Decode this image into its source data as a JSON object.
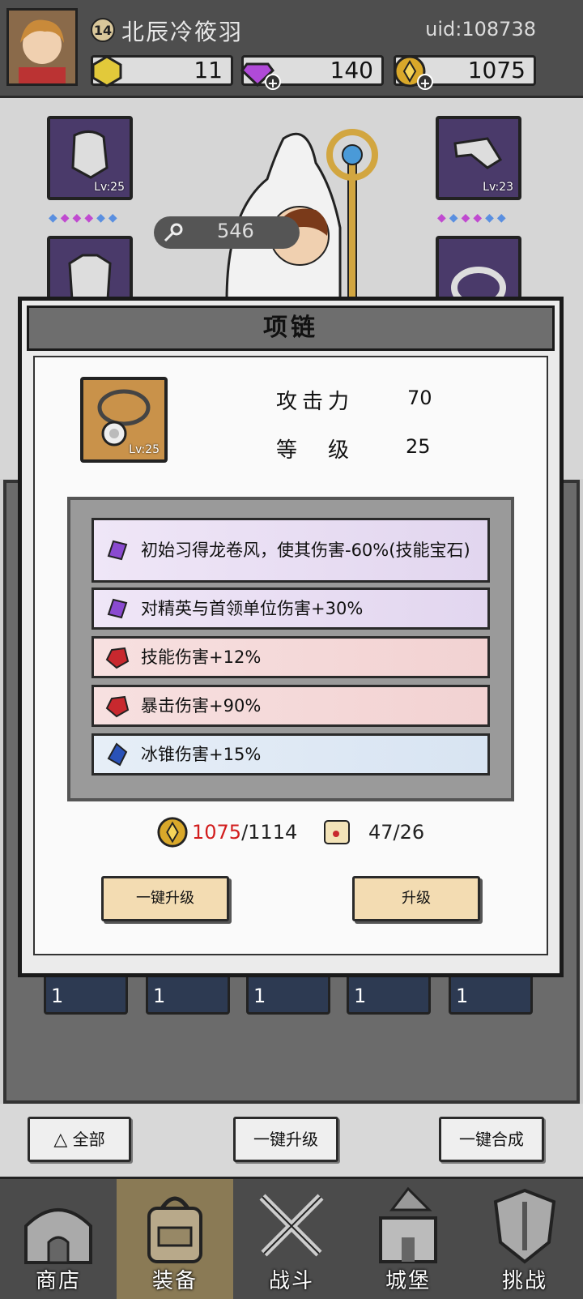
{
  "header": {
    "level": "14",
    "player_name": "北辰冷筱羽",
    "uid": "uid:108738",
    "resources": [
      {
        "icon": "yellow-gem-icon",
        "value": "11"
      },
      {
        "icon": "purple-diamond-icon",
        "value": "140"
      },
      {
        "icon": "gold-coin-icon",
        "value": "1075"
      }
    ]
  },
  "background": {
    "key_count": "546",
    "slots": {
      "helmet_lv": "Lv:25",
      "gloves_lv": "Lv:23"
    }
  },
  "modal": {
    "title": "项链",
    "item_level": "Lv:25",
    "stats": [
      {
        "label": "攻击力",
        "value": "70"
      },
      {
        "label": "等　级",
        "value": "25"
      }
    ],
    "affixes": [
      {
        "color": "purple",
        "text": "初始习得龙卷风，使其伤害-60%(技能宝石)"
      },
      {
        "color": "purple",
        "text": "对精英与首领单位伤害+30%"
      },
      {
        "color": "red",
        "text": "技能伤害+12%"
      },
      {
        "color": "red",
        "text": "暴击伤害+90%"
      },
      {
        "color": "blue",
        "text": "冰锥伤害+15%"
      }
    ],
    "cost": {
      "gold_have": "1075",
      "gold_need": "/1114",
      "scroll": "47/26"
    },
    "buttons": {
      "one_click_upgrade": "一键升级",
      "upgrade": "升级"
    }
  },
  "inventory": {
    "row_counts": [
      "1",
      "1",
      "1",
      "1",
      "1"
    ]
  },
  "actions": {
    "all_filter": "全部",
    "one_click_upgrade": "一键升级",
    "one_click_merge": "一键合成"
  },
  "nav": [
    {
      "label": "商店",
      "icon": "shop-icon"
    },
    {
      "label": "装备",
      "icon": "backpack-icon"
    },
    {
      "label": "战斗",
      "icon": "crossed-swords-icon"
    },
    {
      "label": "城堡",
      "icon": "castle-icon"
    },
    {
      "label": "挑战",
      "icon": "shield-crest-icon"
    }
  ],
  "colors": {
    "accent_cost_red": "#d21d1d",
    "button_tan": "#f3dcb2",
    "affix_purple": "#e2d6ef",
    "affix_red": "#f2d2d2",
    "affix_blue": "#d8e4f2"
  }
}
